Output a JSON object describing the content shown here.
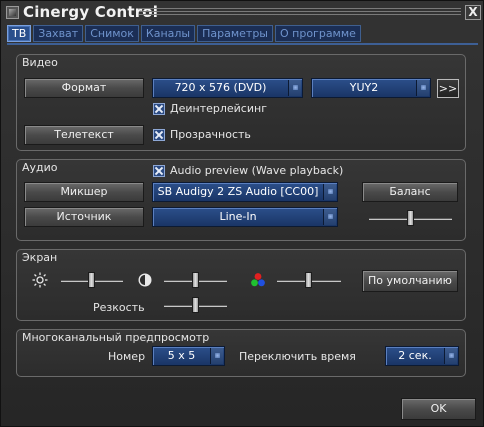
{
  "window": {
    "title": "Cinergy Control",
    "close_label": "X"
  },
  "tabs": [
    {
      "label": "ТВ",
      "active": true
    },
    {
      "label": "Захват",
      "active": false
    },
    {
      "label": "Снимок",
      "active": false
    },
    {
      "label": "Каналы",
      "active": false
    },
    {
      "label": "Параметры",
      "active": false
    },
    {
      "label": "О программе",
      "active": false
    }
  ],
  "video": {
    "group_label": "Видео",
    "format_button": "Формат",
    "resolution_value": "720 x 576 (DVD)",
    "colorspace_value": "YUY2",
    "more_button": ">>",
    "deinterlace_label": "Деинтерлейсинг",
    "deinterlace_checked": true,
    "teletext_button": "Телетекст",
    "transparency_label": "Прозрачность",
    "transparency_checked": true
  },
  "audio": {
    "group_label": "Аудио",
    "preview_label": "Audio preview (Wave playback)",
    "preview_checked": true,
    "mixer_button": "Микшер",
    "mixer_device_value": "SB Audigy 2 ZS Audio [CC00]",
    "balance_button": "Баланс",
    "source_button": "Источник",
    "source_value": "Line-In",
    "balance_level": 0.5
  },
  "screen": {
    "group_label": "Экран",
    "brightness_icon": "brightness-sun-icon",
    "contrast_icon": "contrast-icon",
    "color_icon": "rgb-color-icon",
    "brightness_level": 0.5,
    "contrast_level": 0.5,
    "color_level": 0.5,
    "default_button": "По умолчанию",
    "sharpness_label": "Резкость",
    "sharpness_level": 0.5
  },
  "multichannel": {
    "group_label": "Многоканальный предпросмотр",
    "number_label": "Номер",
    "number_value": "5 x 5",
    "switch_time_label": "Переключить время",
    "switch_time_value": "2 сек."
  },
  "footer": {
    "ok_button": "OK"
  },
  "colors": {
    "accent": "#2a4f8c",
    "background": "#2c2c2c",
    "text": "#e8e8e8"
  }
}
